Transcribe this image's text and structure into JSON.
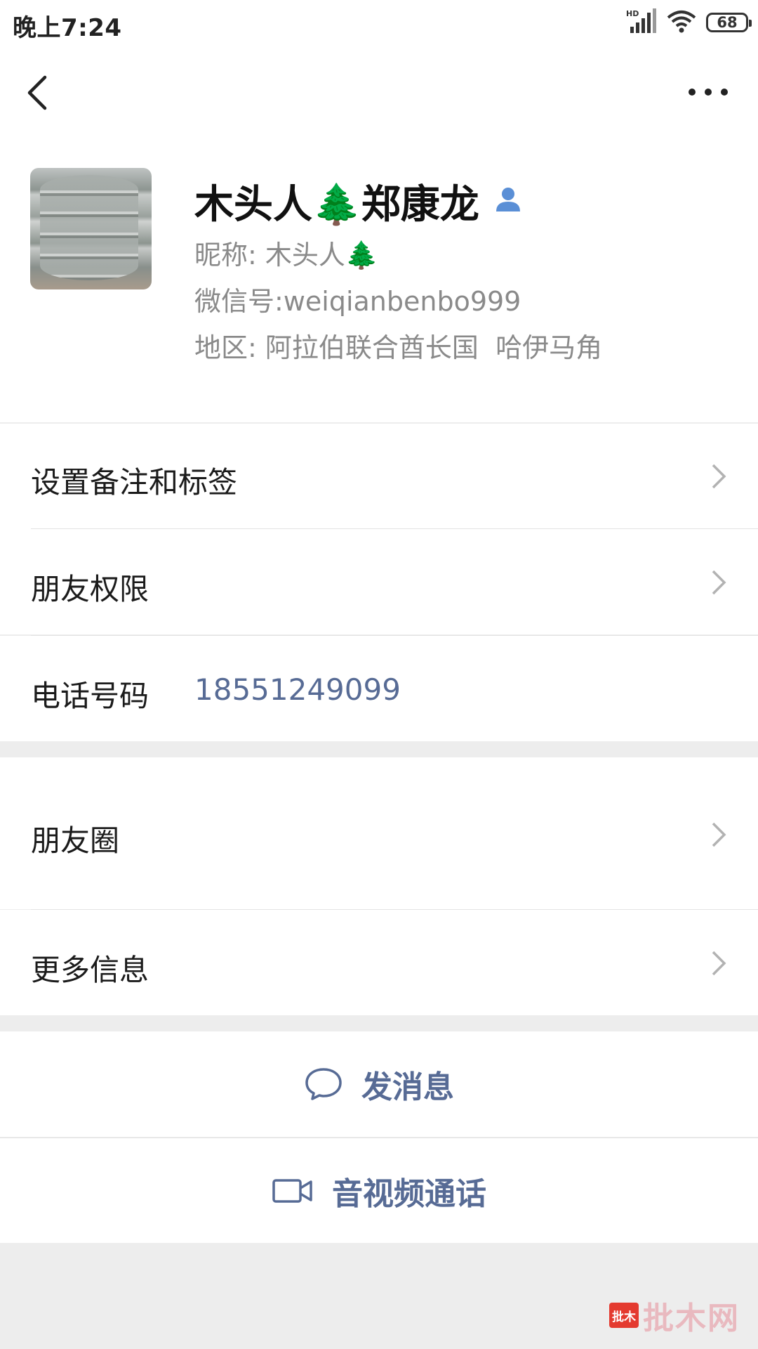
{
  "status_bar": {
    "time": "晚上7:24",
    "network": "HD",
    "battery": "68"
  },
  "nav": {
    "back": "back",
    "more": "more"
  },
  "profile": {
    "name": "木头人🌲郑康龙",
    "nickname_label": "昵称:",
    "nickname": "木头人🌲",
    "wechat_id_label": "微信号:",
    "wechat_id": "weiqianbenbo999",
    "region_label": "地区:",
    "region": "阿拉伯联合酋长国  哈伊马角"
  },
  "rows": {
    "remark": "设置备注和标签",
    "permissions": "朋友权限",
    "phone_label": "电话号码",
    "phone_value": "18551249099",
    "moments": "朋友圈",
    "more_info": "更多信息"
  },
  "actions": {
    "message": "发消息",
    "call": "音视频通话"
  },
  "watermark": {
    "badge": "批木",
    "text": "批木网"
  },
  "colors": {
    "link": "#576b95",
    "background": "#ededed",
    "secondary_text": "#8a8a8a"
  }
}
